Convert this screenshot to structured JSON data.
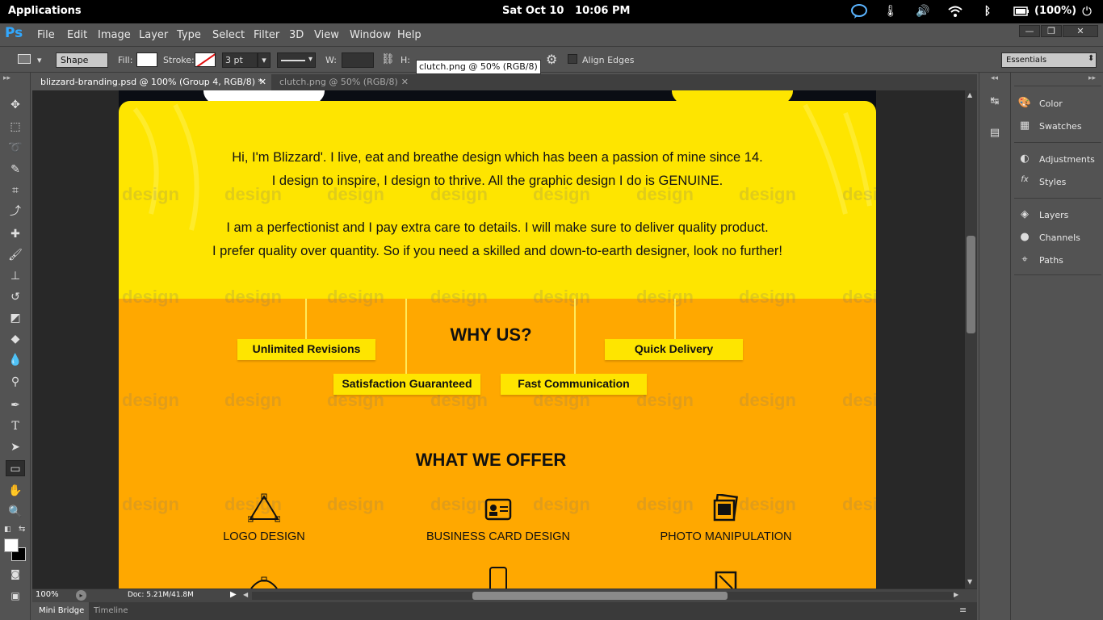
{
  "system": {
    "apps_label": "Applications",
    "clock": "Sat Oct 10   10:06 PM",
    "battery": "(100%)"
  },
  "menubar": {
    "items": [
      "File",
      "Edit",
      "Image",
      "Layer",
      "Type",
      "Select",
      "Filter",
      "3D",
      "View",
      "Window",
      "Help"
    ]
  },
  "options": {
    "mode": "Shape",
    "fill_label": "Fill:",
    "stroke_label": "Stroke:",
    "stroke_width": "3 pt",
    "w_label": "W:",
    "h_label": "H:",
    "align_edges": "Align Edges",
    "workspace": "Essentials"
  },
  "tooltip": "clutch.png @ 50% (RGB/8)",
  "tabs": [
    {
      "label": "blizzard-branding.psd @ 100% (Group 4, RGB/8) *"
    },
    {
      "label": "clutch.png @ 50% (RGB/8)"
    }
  ],
  "canvas": {
    "bio": [
      "Hi, I'm Blizzard'. I live, eat and breathe design which has been a passion of mine since 14.",
      "I design to inspire, I design to thrive. All the graphic design I do is GENUINE.",
      "I am a perfectionist and I pay extra care to details. I will make sure to deliver quality product.",
      "I prefer quality over quantity. So if you need a skilled and down-to-earth designer, look no further!"
    ],
    "why_title": "WHY US?",
    "why_items": [
      "Unlimited Revisions",
      "Quick Delivery",
      "Satisfaction Guaranteed",
      "Fast Communication"
    ],
    "offer_title": "WHAT WE OFFER",
    "offers": [
      "LOGO DESIGN",
      "BUSINESS CARD DESIGN",
      "PHOTO MANIPULATION"
    ],
    "watermark": "design"
  },
  "status": {
    "zoom": "100%",
    "doc": "Doc: 5.21M/41.8M"
  },
  "bottom_tabs": [
    "Mini Bridge",
    "Timeline"
  ],
  "panels": {
    "groups": [
      [
        "Color",
        "Swatches"
      ],
      [
        "Adjustments",
        "Styles"
      ],
      [
        "Layers",
        "Channels",
        "Paths"
      ]
    ]
  },
  "colors": {
    "ps_blue": "#31a8ff",
    "canvas_yellow": "#fee500",
    "canvas_orange": "#ffa800"
  }
}
